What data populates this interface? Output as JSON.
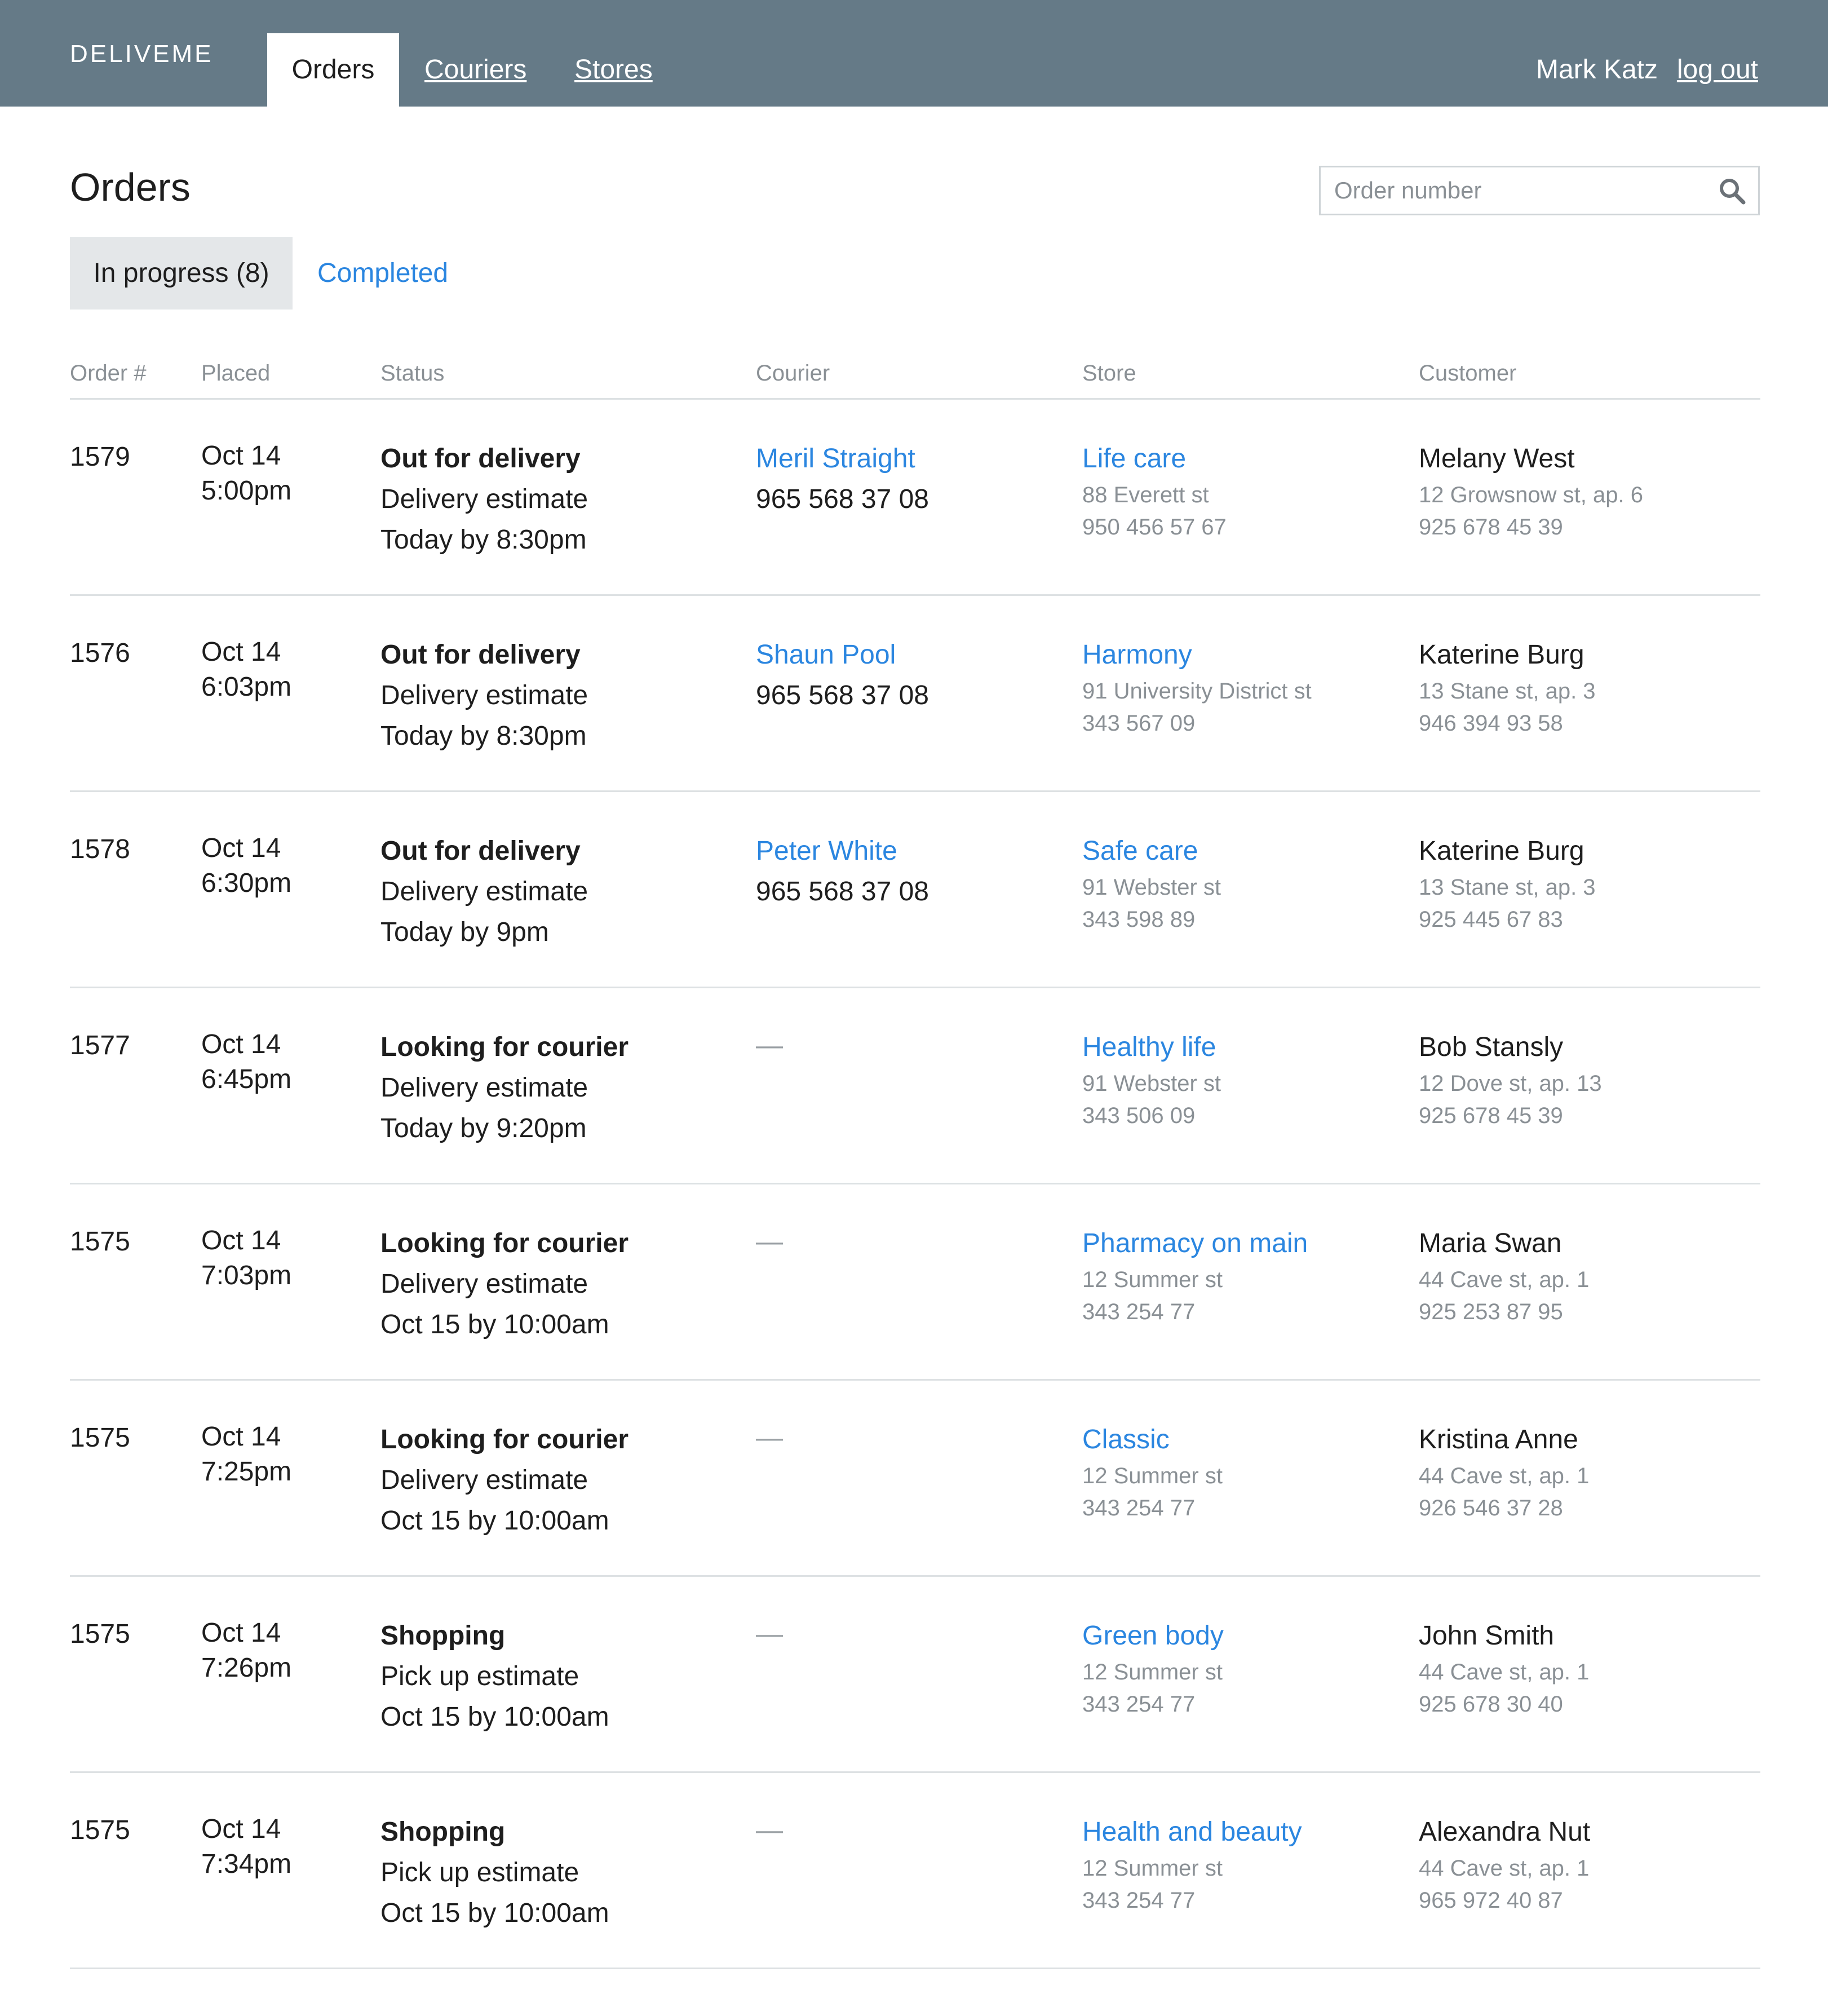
{
  "nav": {
    "brand": "DELIVEME",
    "tabs": [
      {
        "label": "Orders",
        "active": true
      },
      {
        "label": "Couriers",
        "active": false
      },
      {
        "label": "Stores",
        "active": false
      }
    ],
    "user_name": "Mark Katz",
    "logout_label": "log out"
  },
  "page": {
    "title": "Orders",
    "search_placeholder": "Order number",
    "search_value": "",
    "search_icon": "magnifier"
  },
  "subtabs": [
    {
      "label": "In progress (8)",
      "active": true
    },
    {
      "label": "Completed",
      "active": false
    }
  ],
  "table": {
    "headers": [
      "Order #",
      "Placed",
      "Status",
      "Courier",
      "Store",
      "Customer"
    ],
    "rows": [
      {
        "order": "1579",
        "date": "Oct 14",
        "time": "5:00pm",
        "status": "Out for delivery",
        "estimate_label": "Delivery estimate",
        "estimate": "Today by 8:30pm",
        "courier_name": "Meril Straight",
        "courier_phone": "965 568 37 08",
        "store_name": "Life care",
        "store_address": "88 Everett st",
        "store_phone": "950 456 57 67",
        "customer_name": "Melany West",
        "customer_address": "12 Growsnow st, ap. 6",
        "customer_phone": "925 678 45 39"
      },
      {
        "order": "1576",
        "date": "Oct 14",
        "time": "6:03pm",
        "status": "Out for delivery",
        "estimate_label": "Delivery estimate",
        "estimate": "Today by 8:30pm",
        "courier_name": "Shaun Pool",
        "courier_phone": "965 568 37 08",
        "store_name": "Harmony",
        "store_address": "91 University District st",
        "store_phone": "343 567 09",
        "customer_name": "Katerine Burg",
        "customer_address": "13 Stane st, ap. 3",
        "customer_phone": "946 394 93 58"
      },
      {
        "order": "1578",
        "date": "Oct 14",
        "time": "6:30pm",
        "status": "Out for delivery",
        "estimate_label": "Delivery estimate",
        "estimate": "Today by 9pm",
        "courier_name": "Peter White",
        "courier_phone": "965 568 37 08",
        "store_name": "Safe care",
        "store_address": "91 Webster st",
        "store_phone": "343 598 89",
        "customer_name": "Katerine Burg",
        "customer_address": "13 Stane st, ap. 3",
        "customer_phone": "925 445 67 83"
      },
      {
        "order": "1577",
        "date": "Oct 14",
        "time": "6:45pm",
        "status": "Looking for courier",
        "estimate_label": "Delivery estimate",
        "estimate": "Today by 9:20pm",
        "courier_name": "—",
        "courier_phone": "",
        "store_name": "Healthy life",
        "store_address": "91 Webster st",
        "store_phone": "343 506 09",
        "customer_name": "Bob Stansly",
        "customer_address": "12 Dove st, ap. 13",
        "customer_phone": "925 678 45 39"
      },
      {
        "order": "1575",
        "date": "Oct 14",
        "time": "7:03pm",
        "status": "Looking for courier",
        "estimate_label": "Delivery estimate",
        "estimate": "Oct 15 by 10:00am",
        "courier_name": "—",
        "courier_phone": "",
        "store_name": "Pharmacy on main",
        "store_address": "12 Summer st",
        "store_phone": "343 254 77",
        "customer_name": "Maria Swan",
        "customer_address": "44 Cave st, ap. 1",
        "customer_phone": "925 253 87 95"
      },
      {
        "order": "1575",
        "date": "Oct 14",
        "time": "7:25pm",
        "status": "Looking for courier",
        "estimate_label": "Delivery estimate",
        "estimate": "Oct 15 by 10:00am",
        "courier_name": "—",
        "courier_phone": "",
        "store_name": "Classic",
        "store_address": "12 Summer st",
        "store_phone": "343 254 77",
        "customer_name": "Kristina Anne",
        "customer_address": "44 Cave st, ap. 1",
        "customer_phone": "926 546 37 28"
      },
      {
        "order": "1575",
        "date": "Oct 14",
        "time": "7:26pm",
        "status": "Shopping",
        "estimate_label": "Pick up estimate",
        "estimate": "Oct 15 by 10:00am",
        "courier_name": "—",
        "courier_phone": "",
        "store_name": "Green body",
        "store_address": "12 Summer st",
        "store_phone": "343 254 77",
        "customer_name": "John Smith",
        "customer_address": "44 Cave st, ap. 1",
        "customer_phone": "925 678 30 40"
      },
      {
        "order": "1575",
        "date": "Oct 14",
        "time": "7:34pm",
        "status": "Shopping",
        "estimate_label": "Pick up estimate",
        "estimate": "Oct 15 by 10:00am",
        "courier_name": "—",
        "courier_phone": "",
        "store_name": "Health and beauty",
        "store_address": "12 Summer st",
        "store_phone": "343 254 77",
        "customer_name": "Alexandra Nut",
        "customer_address": "44 Cave st, ap. 1",
        "customer_phone": "965 972 40 87"
      }
    ]
  },
  "colors": {
    "topbar": "#657a87",
    "link": "#2b86e0",
    "muted": "#8a9095",
    "active_subtab_bg": "#e4e7e9",
    "rule": "#dde1e3"
  }
}
